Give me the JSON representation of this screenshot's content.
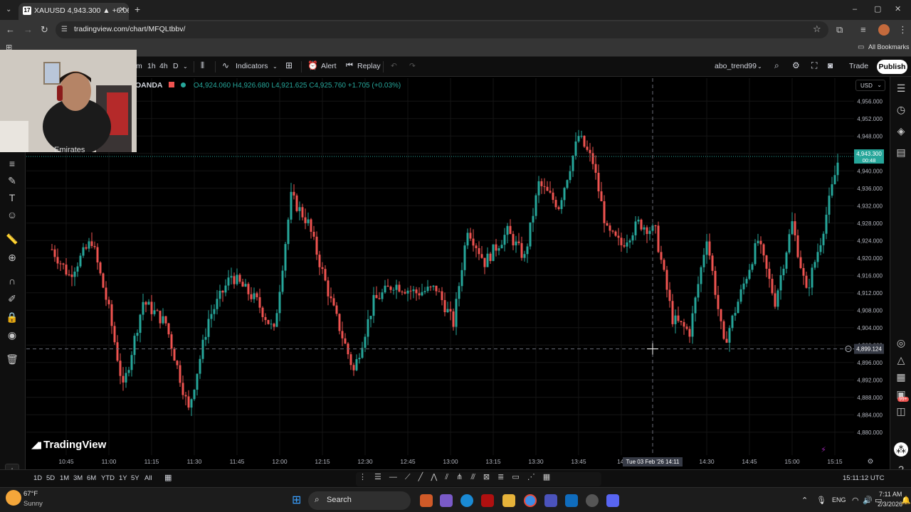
{
  "browser": {
    "tab_title": "XAUUSD 4,943.300 ▲ +6.06% o",
    "url": "tradingview.com/chart/MFQLtbbv/",
    "bookmarks_label": "All Bookmarks"
  },
  "toolbar": {
    "timeframes": [
      "m",
      "1h",
      "4h",
      "D"
    ],
    "indicators_label": "Indicators",
    "alert_label": "Alert",
    "replay_label": "Replay",
    "username": "abo_trend99",
    "trade_label": "Trade",
    "publish_label": "Publish"
  },
  "legend": {
    "broker": "OANDA",
    "open": "O4,924.060",
    "high": "H4,926.680",
    "low": "L4,921.625",
    "close": "C4,925.760",
    "change": "+1.705 (+0.03%)"
  },
  "currency": "USD",
  "chart_data": {
    "type": "candlestick",
    "symbol": "XAUUSD",
    "last_price": "4,943.300",
    "last_price_countdown": "00:48",
    "crosshair_price": "4,899.124",
    "crosshair_time": "Tue 03 Feb '26  14:11",
    "y_ticks": [
      "4,956.000",
      "4,952.000",
      "4,948.000",
      "4,944.000",
      "4,940.000",
      "4,936.000",
      "4,932.000",
      "4,928.000",
      "4,924.000",
      "4,920.000",
      "4,916.000",
      "4,912.000",
      "4,908.000",
      "4,904.000",
      "4,900.000",
      "4,896.000",
      "4,892.000",
      "4,888.000",
      "4,884.000",
      "4,880.000"
    ],
    "y_tick_values": [
      4956,
      4952,
      4948,
      4944,
      4940,
      4936,
      4932,
      4928,
      4924,
      4920,
      4916,
      4912,
      4908,
      4904,
      4900,
      4896,
      4892,
      4888,
      4884,
      4880
    ],
    "ylim": [
      4878,
      4958
    ],
    "x_ticks": [
      "10:45",
      "11:00",
      "11:15",
      "11:30",
      "11:45",
      "12:00",
      "12:15",
      "12:30",
      "12:45",
      "13:00",
      "13:15",
      "13:30",
      "13:45",
      "14:",
      "14:30",
      "14:45",
      "15:00",
      "15:15"
    ],
    "x_tick_minutes": [
      645,
      660,
      675,
      690,
      705,
      720,
      735,
      750,
      765,
      780,
      795,
      810,
      825,
      840,
      870,
      885,
      900,
      915
    ],
    "anchors": [
      [
        640,
        4922
      ],
      [
        646,
        4916
      ],
      [
        654,
        4924
      ],
      [
        660,
        4908
      ],
      [
        665,
        4890
      ],
      [
        672,
        4910
      ],
      [
        680,
        4905
      ],
      [
        688,
        4885
      ],
      [
        695,
        4906
      ],
      [
        703,
        4916
      ],
      [
        712,
        4910
      ],
      [
        718,
        4903
      ],
      [
        724,
        4934
      ],
      [
        730,
        4928
      ],
      [
        738,
        4910
      ],
      [
        746,
        4894
      ],
      [
        753,
        4910
      ],
      [
        760,
        4914
      ],
      [
        768,
        4912
      ],
      [
        775,
        4913
      ],
      [
        781,
        4905
      ],
      [
        786,
        4927
      ],
      [
        792,
        4919
      ],
      [
        800,
        4926
      ],
      [
        806,
        4920
      ],
      [
        811,
        4937
      ],
      [
        818,
        4932
      ],
      [
        825,
        4948
      ],
      [
        830,
        4942
      ],
      [
        835,
        4926
      ],
      [
        840,
        4923
      ],
      [
        846,
        4928
      ],
      [
        852,
        4926
      ],
      [
        858,
        4906
      ],
      [
        864,
        4903
      ],
      [
        870,
        4925
      ],
      [
        876,
        4900
      ],
      [
        882,
        4912
      ],
      [
        888,
        4924
      ],
      [
        894,
        4910
      ],
      [
        900,
        4928
      ],
      [
        905,
        4912
      ],
      [
        910,
        4924
      ],
      [
        916,
        4942
      ]
    ]
  },
  "branding": {
    "logo_text": "TradingView"
  },
  "bottom_bar": {
    "ranges": [
      "1D",
      "5D",
      "1M",
      "3M",
      "6M",
      "YTD",
      "1Y",
      "5Y",
      "All"
    ],
    "clock": "15:11:12 UTC"
  },
  "taskbar": {
    "weather_temp": "67°F",
    "weather_desc": "Sunny",
    "search_label": "Search",
    "lang": "ENG",
    "time": "7:11 AM",
    "date": "2/3/2026",
    "notification_badge": "99+"
  },
  "colors": {
    "up": "#26a69a",
    "down": "#ef5350",
    "accent": "#26a69a",
    "background": "#000000"
  }
}
